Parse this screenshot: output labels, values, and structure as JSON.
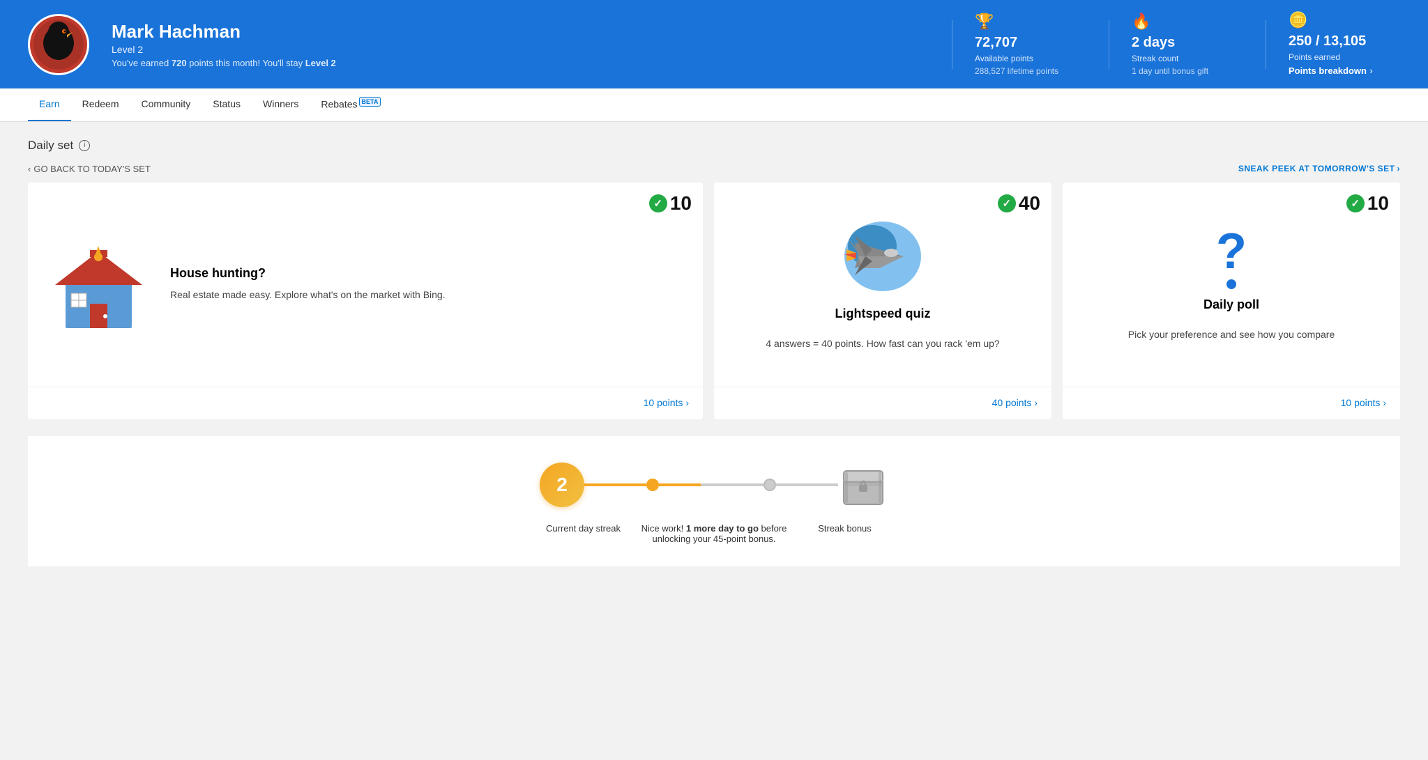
{
  "header": {
    "user_name": "Mark Hachman",
    "user_level": "Level 2",
    "user_message_prefix": "You've earned ",
    "user_message_points": "720",
    "user_message_suffix": " points this month! You'll stay ",
    "user_message_level": "Level 2",
    "stats": {
      "available_points_value": "72,707",
      "available_points_label": "Available points",
      "lifetime_points": "288,527 lifetime points",
      "streak_days_value": "2 days",
      "streak_count_label": "Streak count",
      "streak_bonus_label": "1 day until bonus gift",
      "points_earned_value": "250 / 13,105",
      "points_earned_label": "Points earned",
      "points_breakdown_link": "Points breakdown"
    }
  },
  "nav": {
    "items": [
      {
        "label": "Earn",
        "active": true
      },
      {
        "label": "Redeem",
        "active": false
      },
      {
        "label": "Community",
        "active": false
      },
      {
        "label": "Status",
        "active": false
      },
      {
        "label": "Winners",
        "active": false
      },
      {
        "label": "Rebates",
        "active": false,
        "beta": true
      }
    ]
  },
  "daily_set": {
    "title": "Daily set",
    "back_link": "GO BACK TO TODAY'S SET",
    "sneak_link": "SNEAK PEEK AT TOMORROW'S SET",
    "cards": [
      {
        "id": "house-hunting",
        "points": "10",
        "title": "House hunting?",
        "desc": "Real estate made easy. Explore what's on the market with Bing.",
        "footer_link": "10 points",
        "completed": true
      },
      {
        "id": "lightspeed-quiz",
        "points": "40",
        "title": "Lightspeed quiz",
        "desc": "4 answers = 40 points. How fast can you rack 'em up?",
        "footer_link": "40 points",
        "completed": true
      },
      {
        "id": "daily-poll",
        "points": "10",
        "title": "Daily poll",
        "desc": "Pick your preference and see how you compare",
        "footer_link": "10 points",
        "completed": true
      }
    ]
  },
  "streak": {
    "current_day": "2",
    "current_label": "Current day streak",
    "middle_label_prefix": "Nice work! ",
    "middle_label_bold": "1 more day to go",
    "middle_label_suffix": " before unlocking your 45-point bonus.",
    "bonus_label": "Streak bonus"
  }
}
